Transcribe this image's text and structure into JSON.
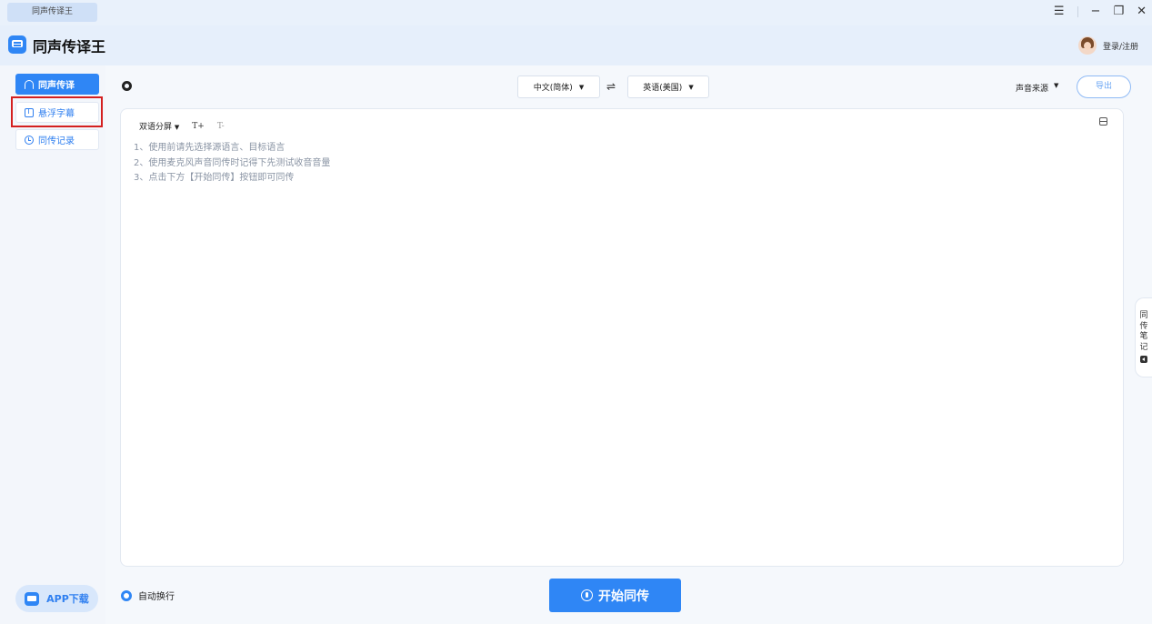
{
  "window": {
    "tab_title": "同声传译王",
    "controls": {
      "menu": "☰",
      "minimize": "−",
      "restore": "❐",
      "close": "✕"
    }
  },
  "header": {
    "app_title": "同声传译王",
    "login_label": "登录/注册"
  },
  "sidebar": {
    "items": [
      {
        "label": "同声传译",
        "icon": "headset-icon",
        "active": true
      },
      {
        "label": "悬浮字幕",
        "icon": "caption-icon",
        "active": false
      },
      {
        "label": "同传记录",
        "icon": "clock-icon",
        "active": false
      }
    ],
    "app_download_label": "APP下载"
  },
  "toolbar": {
    "source_language": "中文(简体)",
    "swap_symbol": "⇌",
    "target_language": "英语(美国)",
    "sound_source_label": "声音来源",
    "export_label": "导出"
  },
  "panel": {
    "view_mode": "双语分屏",
    "font_increase": "T+",
    "font_decrease": "T-",
    "instructions": [
      "1、使用前请先选择源语言、目标语言",
      "2、使用麦克风声音同传时记得下先测试收音音量",
      "3、点击下方【开始同传】按钮即可同传"
    ]
  },
  "notes_tab": {
    "label": "同传笔记"
  },
  "footer": {
    "auto_wrap_label": "自动换行",
    "start_button_label": "开始同传"
  },
  "colors": {
    "accent": "#2f86f5",
    "highlight": "#d42020",
    "background": "#e8f0fb"
  }
}
